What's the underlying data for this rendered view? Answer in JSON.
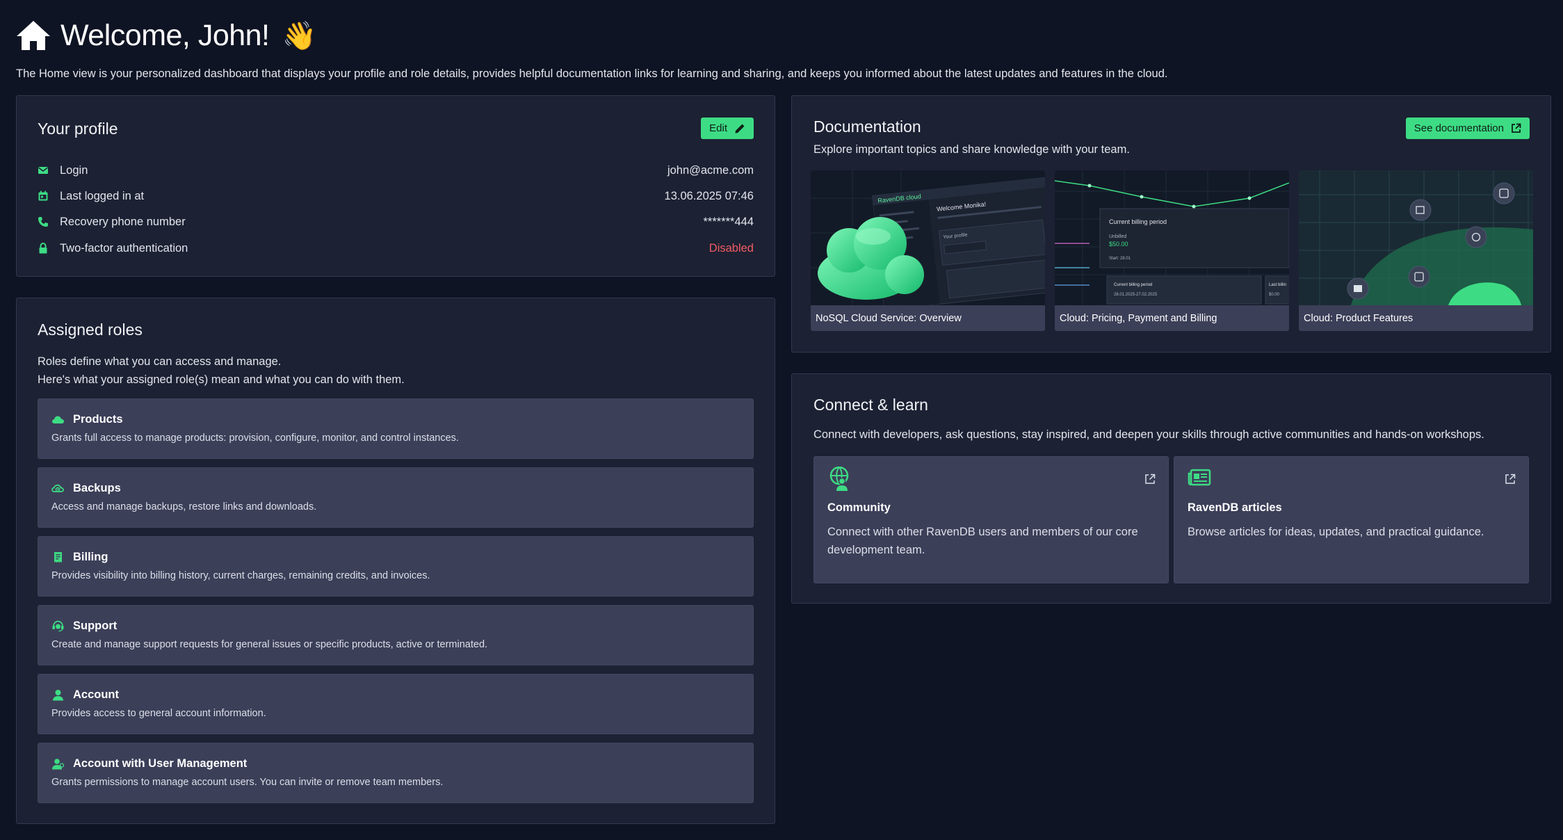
{
  "header": {
    "title": "Welcome, John!",
    "wave": "👋",
    "subtitle": "The Home view is your personalized dashboard that displays your profile and role details, provides helpful documentation links for learning and sharing, and keeps you informed about the latest updates and features in the cloud."
  },
  "profile": {
    "title": "Your profile",
    "edit_label": "Edit",
    "rows": [
      {
        "label": "Login",
        "value": "john@acme.com",
        "icon": "mail-icon"
      },
      {
        "label": "Last logged in at",
        "value": "13.06.2025 07:46",
        "icon": "calendar-icon"
      },
      {
        "label": "Recovery phone number",
        "value": "*******444",
        "icon": "phone-icon"
      },
      {
        "label": "Two-factor authentication",
        "value": "Disabled",
        "icon": "lock-icon"
      }
    ]
  },
  "roles": {
    "title": "Assigned roles",
    "desc_line1": "Roles define what you can access and manage.",
    "desc_line2": "Here's what your assigned role(s) mean and what you can do with them.",
    "items": [
      {
        "name": "Products",
        "desc": "Grants full access to manage products: provision, configure, monitor, and control instances.",
        "icon": "cloud-icon"
      },
      {
        "name": "Backups",
        "desc": "Access and manage backups, restore links and downloads.",
        "icon": "backup-icon"
      },
      {
        "name": "Billing",
        "desc": "Provides visibility into billing history, current charges, remaining credits, and invoices.",
        "icon": "billing-icon"
      },
      {
        "name": "Support",
        "desc": "Create and manage support requests for general issues or specific products, active or terminated.",
        "icon": "support-icon"
      },
      {
        "name": "Account",
        "desc": "Provides access to general account information.",
        "icon": "user-icon"
      },
      {
        "name": "Account with User Management",
        "desc": "Grants permissions to manage account users. You can invite or remove team members.",
        "icon": "users-icon"
      }
    ]
  },
  "docs": {
    "title": "Documentation",
    "desc": "Explore important topics and share knowledge with your team.",
    "see_label": "See documentation",
    "cards": [
      {
        "title": "NoSQL Cloud Service: Overview"
      },
      {
        "title": "Cloud: Pricing, Payment and Billing"
      },
      {
        "title": "Cloud: Product Features"
      }
    ],
    "thumb_text": {
      "brand": "RavenDB cloud",
      "welcome": "Welcome Monika!",
      "your_profile": "Your profile",
      "billing_period": "Current billing period",
      "unbilled": "Unbilled",
      "amount": "$50.00",
      "start": "Start: 28.01",
      "cbp": "Current billing period",
      "range": "28.01.2025-27.02.2025",
      "last": "Last billin",
      "last_amount": "$0.00"
    }
  },
  "connect": {
    "title": "Connect & learn",
    "desc": "Connect with developers, ask questions, stay inspired, and deepen your skills through active communities and hands-on workshops.",
    "cards": [
      {
        "title": "Community",
        "desc": "Connect with other RavenDB users and members of our core development team.",
        "icon": "community-icon"
      },
      {
        "title": "RavenDB articles",
        "desc": "Browse articles for ideas, updates, and practical guidance.",
        "icon": "articles-icon"
      }
    ]
  },
  "colors": {
    "accent": "#3ddc84",
    "danger": "#f25c63",
    "background": "#0f1424",
    "panel": "#1c2133",
    "card": "#3c3f58"
  }
}
